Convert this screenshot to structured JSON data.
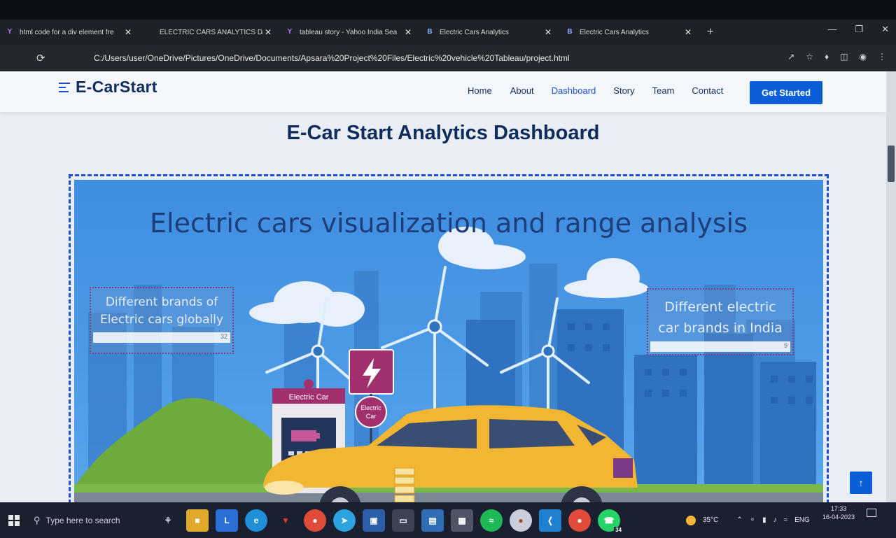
{
  "browser": {
    "tabs": [
      {
        "title": "html code for a div element fre",
        "favicon": "Y",
        "close": "✕"
      },
      {
        "title": "ELECTRIC CARS ANALYTICS DA",
        "favicon": "",
        "close": "✕"
      },
      {
        "title": "tableau story - Yahoo India Sea",
        "favicon": "Y",
        "close": "✕"
      },
      {
        "title": "Electric Cars Analytics",
        "favicon": "B",
        "close": "✕"
      },
      {
        "title": "Electric Cars Analytics",
        "favicon": "B",
        "close": "✕"
      }
    ],
    "new_tab": "+",
    "url": "C:/Users/user/OneDrive/Pictures/OneDrive/Documents/Apsara%20Project%20Files/Electric%20vehicle%20Tableau/project.html"
  },
  "site": {
    "logo": "E-CarStart",
    "nav": [
      "Home",
      "About",
      "Dashboard",
      "Story",
      "Team",
      "Contact"
    ],
    "active_nav": "Dashboard",
    "cta": "Get Started",
    "page_title": "E-Car Start Analytics Dashboard"
  },
  "story": {
    "title": "Electric cars visualization and range analysis",
    "kpis": [
      {
        "label_line1": "Different brands of",
        "label_line2": "Electric cars globally",
        "value": "32"
      },
      {
        "label_line1": "Different electric",
        "label_line2": "car brands in India",
        "value": "9"
      }
    ],
    "station_sign": "Electric Car",
    "round_sign_line1": "Electric",
    "round_sign_line2": "Car",
    "car_color": "#f2b632"
  },
  "taskbar": {
    "search_placeholder": "Type here to search",
    "temperature": "35°C",
    "language": "ENG",
    "time": "17:33",
    "date": "16-04-2023",
    "whatsapp_badge": "34"
  },
  "colors": {
    "brand": "#0b5ed7",
    "navy": "#0f2c5c",
    "accent_purple": "#9b2f7a"
  }
}
